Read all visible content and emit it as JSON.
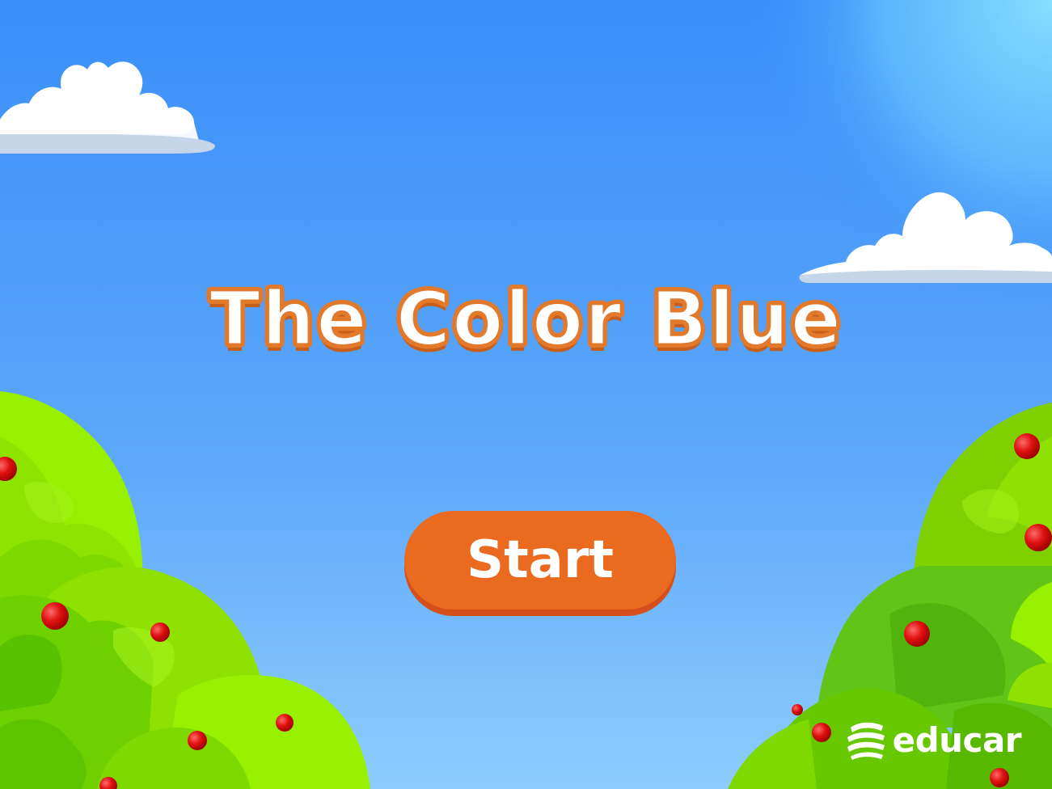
{
  "game": {
    "title": "The Color Blue",
    "start_label": "Start",
    "brand": "educar"
  },
  "colors": {
    "sky_top": "#3a8ef8",
    "sky_bottom": "#8ecdfd",
    "sun": "#86d8ff",
    "accent_orange": "#ea6a20",
    "title_outline": "#e2792b",
    "bush_light": "#8ee100",
    "bush_dark": "#62c417",
    "berry": "#e01010"
  },
  "icons": {
    "logo": "educar-logo-icon"
  }
}
